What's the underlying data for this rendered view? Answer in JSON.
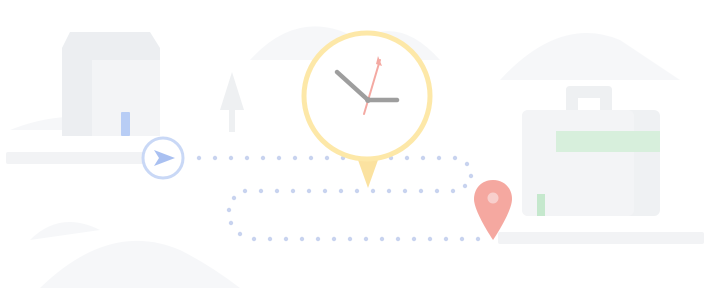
{
  "illustration": {
    "icons": {
      "house": "house-icon",
      "tree": "tree-icon",
      "start": "start-arrow-icon",
      "clock": "clock-icon",
      "destination": "map-pin-icon",
      "briefcase": "briefcase-icon"
    },
    "colors": {
      "background": "#ffffff",
      "clock_ring": "#fde8a8",
      "clock_pointer": "#fbe2a0",
      "clock_hands": "#9e9e9e",
      "clock_second_hand": "#f4a9a2",
      "start_circle": "#c9d8f6",
      "start_arrow": "#a9c0f1",
      "route_dots": "#c8d3ef",
      "map_pin": "#f5a8a0",
      "map_pin_center": "#f8cfcc",
      "house_door": "#a9c0f1",
      "briefcase_stripe": "#cdebd3",
      "briefcase_tag": "#b9e2c2",
      "ground": "#f2f3f5",
      "mountains": "#f5f6f8"
    }
  }
}
